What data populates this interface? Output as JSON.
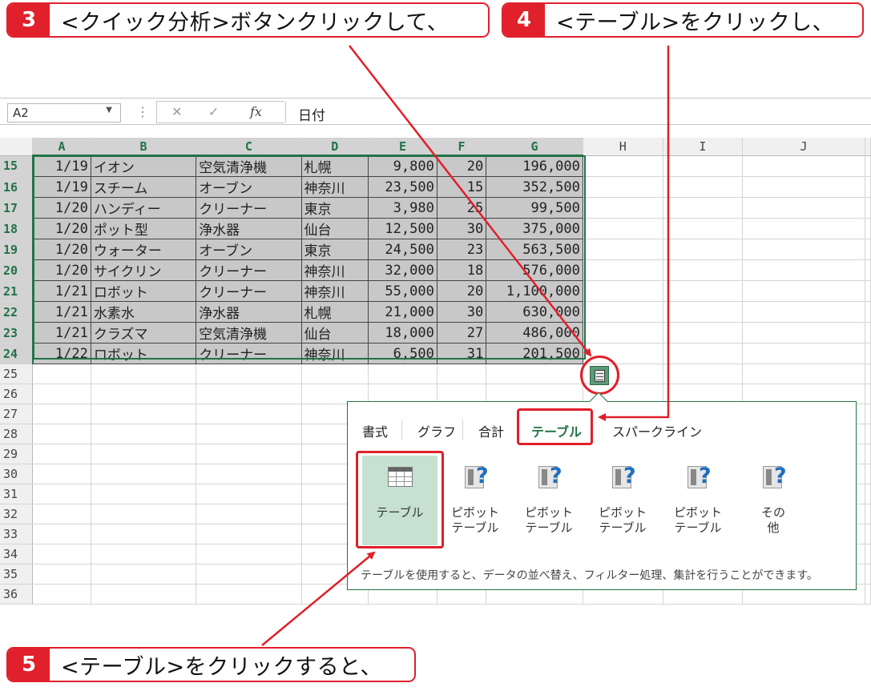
{
  "callouts": [
    {
      "num": "3",
      "text": "<クイック分析>ボタンクリックして、"
    },
    {
      "num": "4",
      "text": "<テーブル>をクリックし、"
    },
    {
      "num": "5",
      "text": "<テーブル>をクリックすると、"
    }
  ],
  "formula_bar": {
    "name_box": "A2",
    "fx_label": "fx",
    "cancel_icon": "✕",
    "enter_icon": "✓",
    "value": "日付"
  },
  "columns": [
    "A",
    "B",
    "C",
    "D",
    "E",
    "F",
    "G",
    "H",
    "I",
    "J"
  ],
  "rows": [
    {
      "num": "15",
      "cells": [
        "1/19",
        "イオン",
        "空気清浄機",
        "札幌",
        "9,800",
        "20",
        "196,000"
      ]
    },
    {
      "num": "16",
      "cells": [
        "1/19",
        "スチーム",
        "オーブン",
        "神奈川",
        "23,500",
        "15",
        "352,500"
      ]
    },
    {
      "num": "17",
      "cells": [
        "1/20",
        "ハンディー",
        "クリーナー",
        "東京",
        "3,980",
        "25",
        "99,500"
      ]
    },
    {
      "num": "18",
      "cells": [
        "1/20",
        "ポット型",
        "浄水器",
        "仙台",
        "12,500",
        "30",
        "375,000"
      ]
    },
    {
      "num": "19",
      "cells": [
        "1/20",
        "ウォーター",
        "オーブン",
        "東京",
        "24,500",
        "23",
        "563,500"
      ]
    },
    {
      "num": "20",
      "cells": [
        "1/20",
        "サイクリン",
        "クリーナー",
        "神奈川",
        "32,000",
        "18",
        "576,000"
      ]
    },
    {
      "num": "21",
      "cells": [
        "1/21",
        "ロボット",
        "クリーナー",
        "神奈川",
        "55,000",
        "20",
        "1,100,000"
      ]
    },
    {
      "num": "22",
      "cells": [
        "1/21",
        "水素水",
        "浄水器",
        "札幌",
        "21,000",
        "30",
        "630,000"
      ]
    },
    {
      "num": "23",
      "cells": [
        "1/21",
        "クラズマ",
        "空気清浄機",
        "仙台",
        "18,000",
        "27",
        "486,000"
      ]
    },
    {
      "num": "24",
      "cells": [
        "1/22",
        "ロボット",
        "クリーナー",
        "神奈川",
        "6,500",
        "31",
        "201,500"
      ]
    }
  ],
  "empty_rows": [
    "25",
    "26",
    "27",
    "28",
    "29",
    "30",
    "31",
    "32",
    "33",
    "34",
    "35",
    "36"
  ],
  "quick_analysis": {
    "button_icon": "quick-analysis-icon",
    "tabs": [
      "書式",
      "グラフ",
      "合計",
      "テーブル",
      "スパークライン"
    ],
    "active_tab": "テーブル",
    "options": [
      {
        "label": "テーブル",
        "icon": "table-icon"
      },
      {
        "label": "ピボット\nテーブル",
        "icon": "pivot-table-icon"
      },
      {
        "label": "ピボット\nテーブル",
        "icon": "pivot-table-icon"
      },
      {
        "label": "ピボット\nテーブル",
        "icon": "pivot-table-icon"
      },
      {
        "label": "ピボット\nテーブル",
        "icon": "pivot-table-icon"
      },
      {
        "label": "その\n他",
        "icon": "more-icon"
      }
    ],
    "description": "テーブルを使用すると、データの並べ替え、フィルター処理、集計を行うことができます。"
  },
  "colors": {
    "accent_red": "#e0202a",
    "excel_green": "#217346",
    "selection_gray": "#c8c8c8",
    "highlight_green": "#c6e1d0"
  }
}
